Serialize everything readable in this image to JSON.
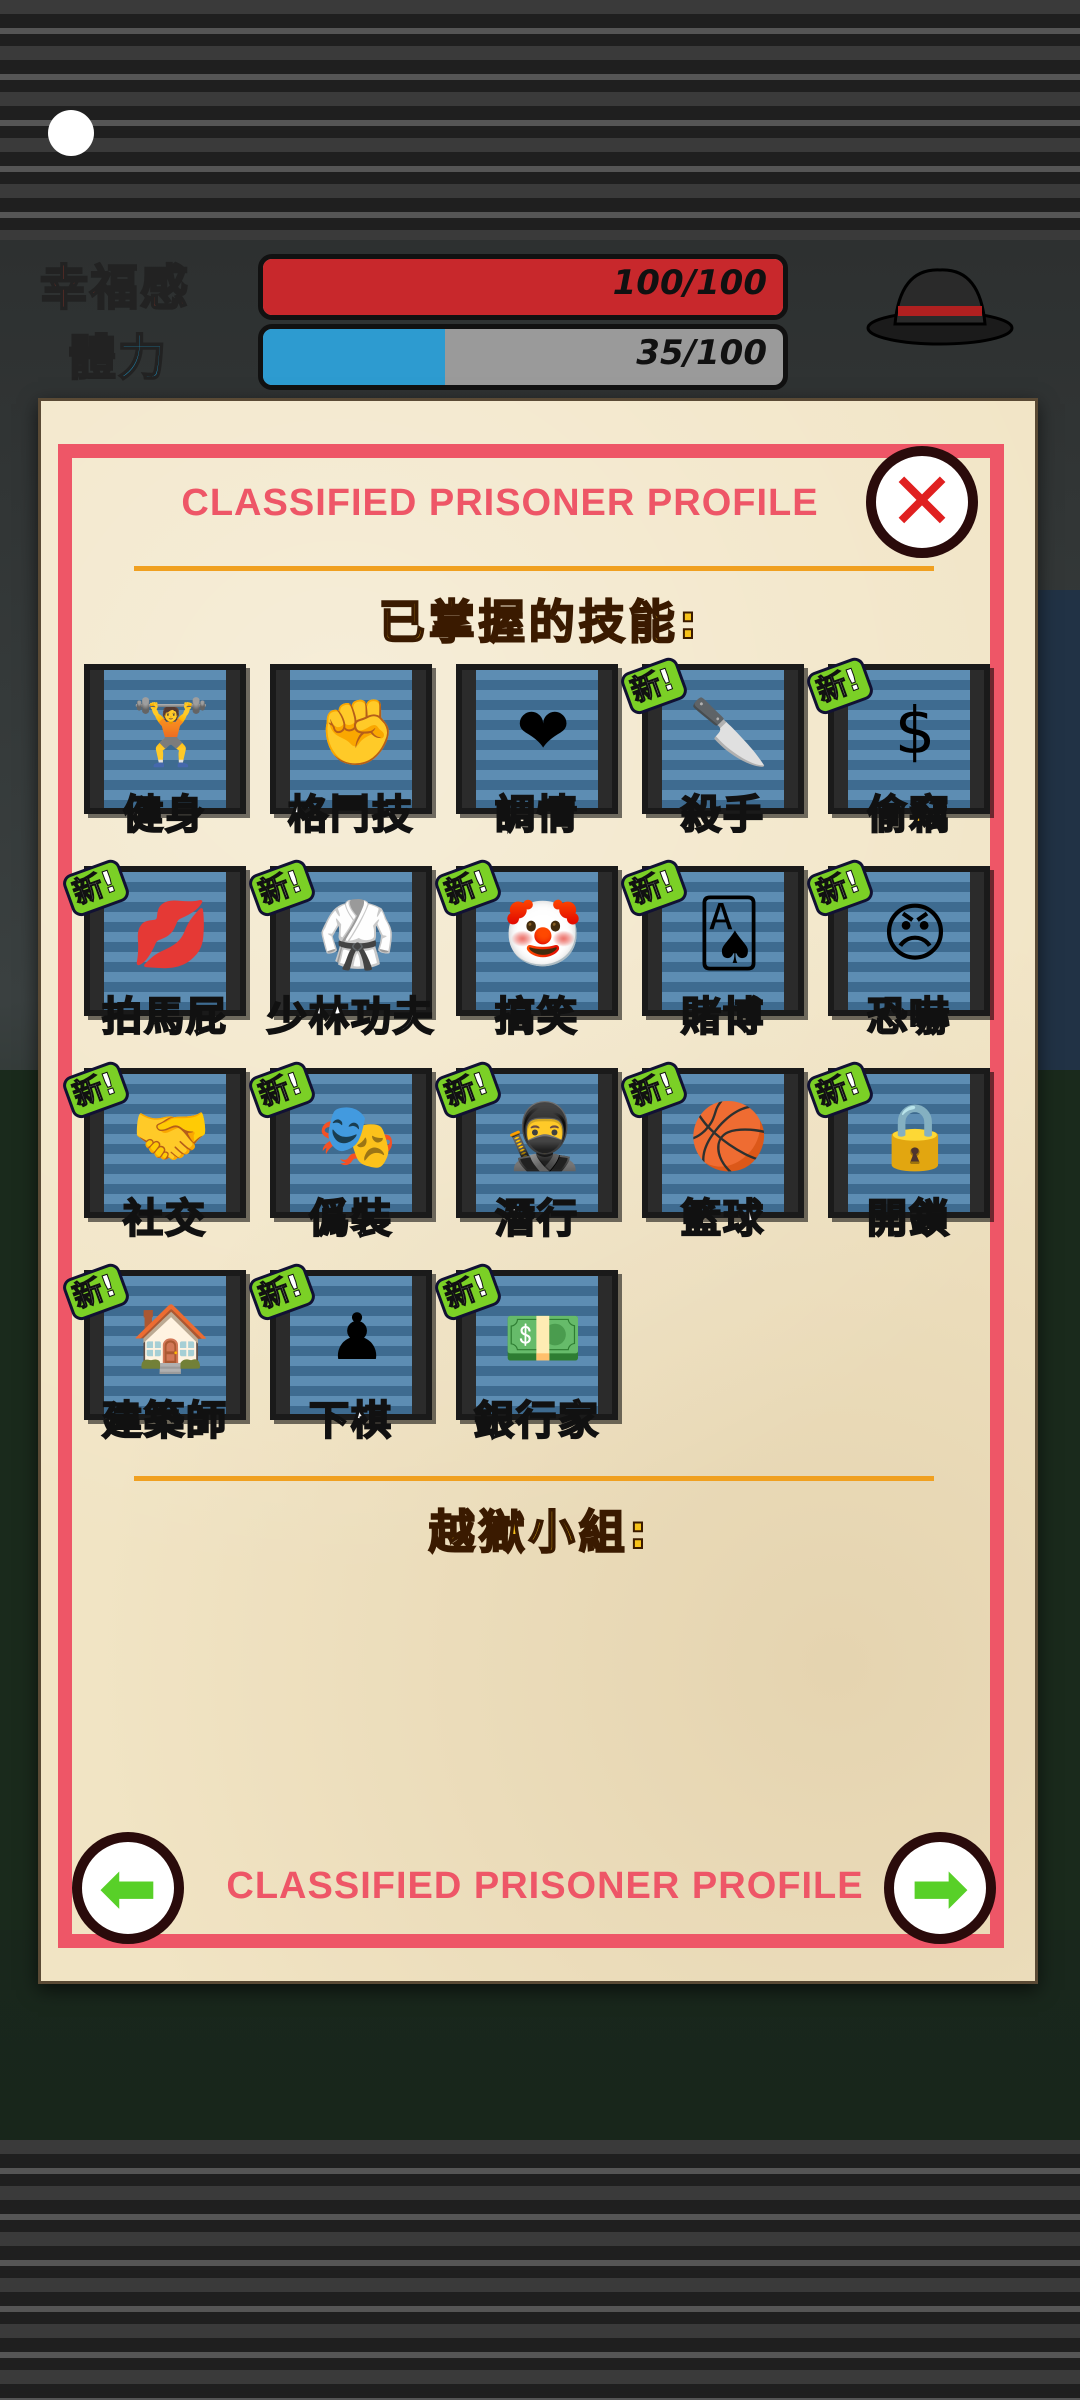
{
  "stats": [
    {
      "label": "幸福感",
      "value": "100/100",
      "fill": 1.0,
      "color": "#c8282c",
      "label_color": "#d0402a"
    },
    {
      "label": "體力",
      "value": "35/100",
      "fill": 0.35,
      "color": "#2d9bd0",
      "label_color": "#1ea2d8"
    }
  ],
  "panel": {
    "title": "CLASSIFIED PRISONER PROFILE",
    "footer_title": "CLASSIFIED PRISONER PROFILE",
    "skills_heading": "已掌握的技能:",
    "team_heading": "越獄小組:",
    "close_glyph": "✕",
    "prev_glyph": "⬅",
    "next_glyph": "➡"
  },
  "new_badge": "新!",
  "skills": [
    {
      "name": "健身",
      "icon": "dumbbell-icon",
      "glyph": "🏋",
      "is_new": false,
      "gold": false
    },
    {
      "name": "格鬥技",
      "icon": "fist-icon",
      "glyph": "✊",
      "is_new": false,
      "gold": false
    },
    {
      "name": "調情",
      "icon": "love-heart-icon",
      "glyph": "❤",
      "is_new": false,
      "gold": false
    },
    {
      "name": "殺手",
      "icon": "knife-hand-icon",
      "glyph": "🔪",
      "is_new": true,
      "gold": false
    },
    {
      "name": "偷竊",
      "icon": "dollar-hand-icon",
      "glyph": "$",
      "is_new": true,
      "gold": true
    },
    {
      "name": "拍馬屁",
      "icon": "butt-kiss-icon",
      "glyph": "💋",
      "is_new": true,
      "gold": false
    },
    {
      "name": "少林功夫",
      "icon": "kung-fu-icon",
      "glyph": "🥋",
      "is_new": true,
      "gold": false
    },
    {
      "name": "搞笑",
      "icon": "jester-icon",
      "glyph": "🤡",
      "is_new": true,
      "gold": false
    },
    {
      "name": "賭博",
      "icon": "cards-money-icon",
      "glyph": "🂡",
      "is_new": true,
      "gold": false
    },
    {
      "name": "恐嚇",
      "icon": "angry-face-icon",
      "glyph": "😠",
      "is_new": true,
      "gold": false
    },
    {
      "name": "社交",
      "icon": "handshake-icon",
      "glyph": "🤝",
      "is_new": true,
      "gold": false
    },
    {
      "name": "僞裝",
      "icon": "disguise-icon",
      "glyph": "🎭",
      "is_new": true,
      "gold": false
    },
    {
      "name": "潛行",
      "icon": "ninja-icon",
      "glyph": "🥷",
      "is_new": true,
      "gold": false
    },
    {
      "name": "籃球",
      "icon": "basketball-icon",
      "glyph": "🏀",
      "is_new": true,
      "gold": false
    },
    {
      "name": "開鎖",
      "icon": "lock-pick-icon",
      "glyph": "🔒",
      "is_new": true,
      "gold": false
    },
    {
      "name": "建築師",
      "icon": "house-pencil-icon",
      "glyph": "🏠",
      "is_new": true,
      "gold": false
    },
    {
      "name": "下棋",
      "icon": "chessboard-icon",
      "glyph": "♟",
      "is_new": true,
      "gold": false
    },
    {
      "name": "銀行家",
      "icon": "money-ledger-icon",
      "glyph": "💵",
      "is_new": true,
      "gold": false
    }
  ]
}
